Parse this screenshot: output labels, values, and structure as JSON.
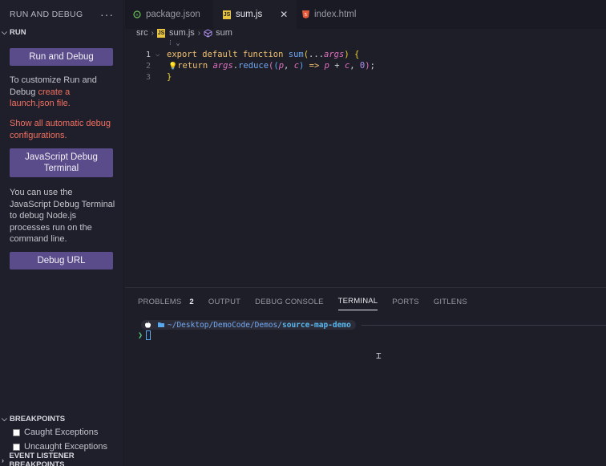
{
  "sidebar": {
    "title": "RUN AND DEBUG",
    "more": "···",
    "section_run": "RUN",
    "run_button": "Run and Debug",
    "customize_text": "To customize Run and Debug ",
    "customize_link": "create a launch.json file.",
    "show_all_link": "Show all automatic debug configurations.",
    "js_terminal_button": "JavaScript Debug Terminal",
    "js_terminal_text": "You can use the JavaScript Debug Terminal to debug Node.js processes run on the command line.",
    "debug_url_button": "Debug URL",
    "breakpoints_section": "BREAKPOINTS",
    "caught_exceptions": "Caught Exceptions",
    "uncaught_exceptions": "Uncaught Exceptions",
    "event_listener_section": "EVENT LISTENER BREAKPOINTS"
  },
  "tabs": [
    {
      "label": "package.json",
      "icon": "npm-icon",
      "active": false
    },
    {
      "label": "sum.js",
      "icon": "js-icon",
      "active": true
    },
    {
      "label": "index.html",
      "icon": "html-icon",
      "active": false
    }
  ],
  "breadcrumb": {
    "folder": "src",
    "file": "sum.js",
    "symbol": "sum"
  },
  "editor": {
    "line_numbers": [
      "1",
      "2",
      "3"
    ],
    "codelens_hint": "⁝ ⌄",
    "line1": {
      "kw1": "export ",
      "kw2": "default ",
      "kw3": "function ",
      "fn": "sum",
      "p1": "(",
      "spread": "...",
      "param": "args",
      "p2": ") ",
      "brace": "{"
    },
    "line2": {
      "bulb": "💡",
      "kw": "return ",
      "obj": "args",
      "dot": ".",
      "method": "reduce",
      "p1": "(",
      "p2": "(",
      "a": "p",
      "comma": ", ",
      "b": "c",
      "p3": ")",
      "arrow": " => ",
      "a2": "p",
      "plus": " + ",
      "b2": "c",
      "comma2": ", ",
      "zero": "0",
      "p4": ")",
      "semi": ";"
    },
    "line3": {
      "brace": "}"
    }
  },
  "panel": {
    "tabs": [
      "PROBLEMS",
      "OUTPUT",
      "DEBUG CONSOLE",
      "TERMINAL",
      "PORTS",
      "GITLENS"
    ],
    "problems_count": "2",
    "active_tab": "TERMINAL",
    "prompt_path": "~/Desktop/DemoCode/Demos/",
    "prompt_dir": "source-map-demo",
    "caret": "❯"
  }
}
